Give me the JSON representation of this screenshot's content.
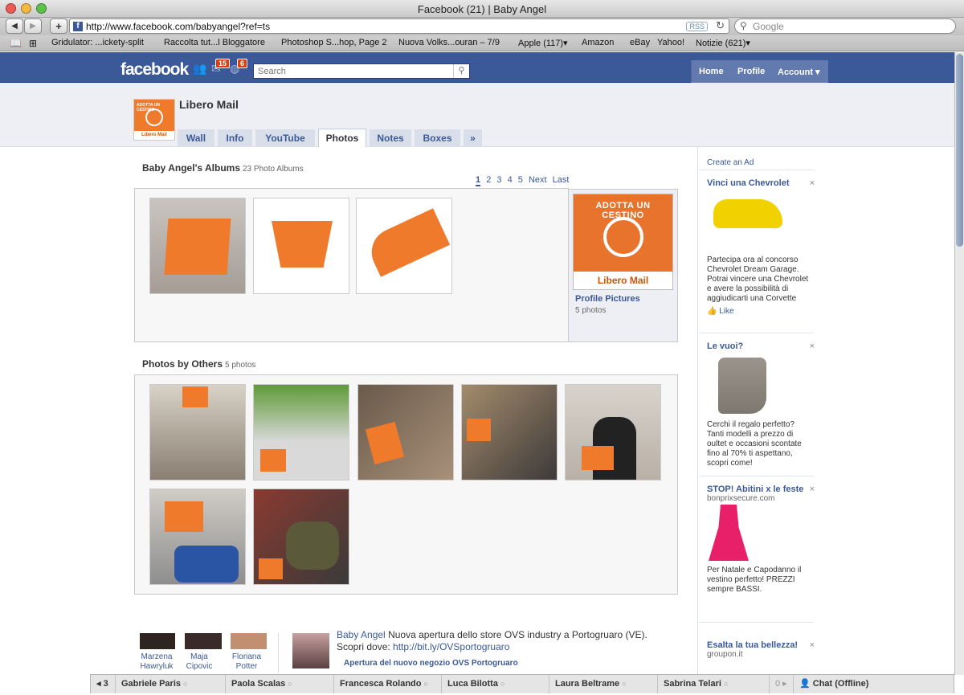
{
  "browser": {
    "window_title": "Facebook (21) | Baby Angel",
    "url": "http://www.facebook.com/babyangel?ref=ts",
    "rss_label": "RSS",
    "google_placeholder": "Google",
    "bookmarks": [
      "Gridulator: ...ickety-split",
      "Raccolta tut...l Bloggatore",
      "Photoshop S...hop, Page 2",
      "Nuova Volks...ouran – 7/9",
      "Apple (117)▾",
      "Amazon",
      "eBay",
      "Yahoo!",
      "Notizie (621)▾"
    ]
  },
  "fb_header": {
    "logo": "facebook",
    "friend_requests_badge": "",
    "messages_badge": "15",
    "notifications_badge": "6",
    "search_placeholder": "Search",
    "nav": [
      "Home",
      "Profile",
      "Account ▾"
    ]
  },
  "profile": {
    "name": "Libero Mail",
    "avatar_top_text": "ADOTTA UN CESTINO",
    "avatar_bottom_text": "Libero Mail",
    "tabs": [
      "Wall",
      "Info",
      "YouTube",
      "Photos",
      "Notes",
      "Boxes",
      "»"
    ],
    "active_tab": "Photos"
  },
  "albums": {
    "title": "Baby Angel's Albums",
    "count": "23 Photo Albums",
    "pager": [
      "1",
      "2",
      "3",
      "4",
      "5",
      "Next",
      "Last"
    ],
    "profile_album": {
      "img_top": "ADOTTA UN CESTINO",
      "img_bottom": "Libero Mail",
      "name": "Profile Pictures",
      "count": "5 photos"
    }
  },
  "others": {
    "title": "Photos by Others",
    "count": "5 photos"
  },
  "ads": {
    "create": "Create an Ad",
    "items": [
      {
        "title": "Vinci una Chevrolet",
        "body": "Partecipa ora al concorso Chevrolet Dream Garage. Potrai vincere una Chevrolet e avere la possibilità di aggiudicarti una Corvette",
        "like": "Like"
      },
      {
        "title": "Le vuoi?",
        "body": "Cerchi il regalo perfetto? Tanti modelli a prezzo di oultet e occasioni scontate fino al 70% ti aspettano, scopri come!"
      },
      {
        "title": "STOP! Abitini x le feste",
        "domain": "bonprixsecure.com",
        "body": "Per Natale e Capodanno il vestino perfetto! PREZZI sempre BASSI."
      },
      {
        "title": "Esalta la tua bellezza!",
        "domain": "groupon.it"
      }
    ],
    "close": "×"
  },
  "bottom": {
    "friends": [
      {
        "first": "Marzena",
        "last": "Hawryluk"
      },
      {
        "first": "Maja",
        "last": "Cipovic"
      },
      {
        "first": "Floriana",
        "last": "Potter"
      }
    ],
    "post_author": "Baby Angel",
    "post_text": "Nuova apertura dello store OVS industry a Portogruaro (VE). Scopri dove:",
    "post_link": "http://bit.ly/OVSportogruaro",
    "post_attachment": "Apertura del nuovo negozio OVS Portogruaro"
  },
  "chat": {
    "prev": "◂ 3",
    "names": [
      "Gabriele Paris",
      "Paola Scalas",
      "Francesca Rolando",
      "Luca Bilotta",
      "Laura Beltrame",
      "Sabrina Telari"
    ],
    "next": "0 ▸",
    "status": "Chat (Offline)"
  }
}
